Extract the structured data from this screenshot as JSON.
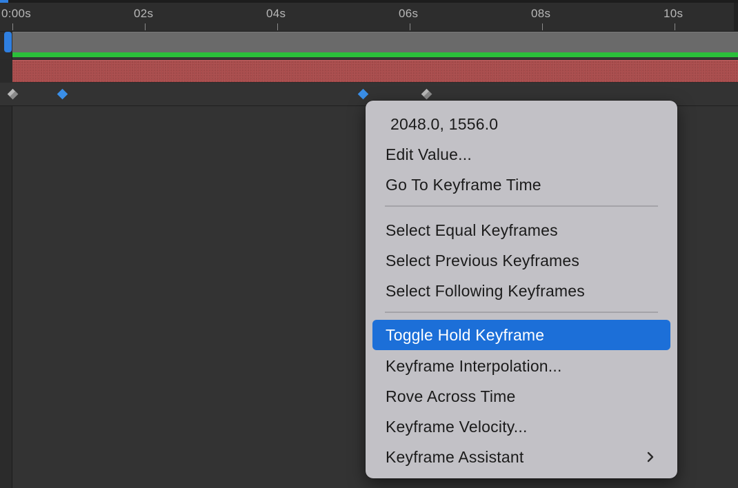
{
  "timeline": {
    "ruler_labels": [
      "0:00s",
      "02s",
      "04s",
      "06s",
      "08s",
      "10s"
    ],
    "colors": {
      "work_bar": "#6a6a6a",
      "green_bar": "#2bbf3a",
      "layer_bar": "#a84a4a",
      "keyframe_selected": "#3a8fe8",
      "keyframe_unselected": "#b9b9b9",
      "playhead": "#2f7fe0"
    },
    "keyframes": [
      {
        "time": "00s",
        "selected": false
      },
      {
        "time": "0.75s",
        "selected": true
      },
      {
        "time": "5.3s",
        "selected": true
      },
      {
        "time": "6.25s",
        "selected": false
      }
    ]
  },
  "context_menu": {
    "value": "2048.0, 1556.0",
    "group1": [
      "Edit Value...",
      "Go To Keyframe Time"
    ],
    "group2": [
      "Select Equal Keyframes",
      "Select Previous Keyframes",
      "Select Following Keyframes"
    ],
    "group3": [
      "Toggle Hold Keyframe",
      "Keyframe Interpolation...",
      "Rove Across Time",
      "Keyframe Velocity...",
      "Keyframe Assistant"
    ],
    "selected_item": "Toggle Hold Keyframe",
    "submenu_icon": "chevron-right-icon",
    "highlight_color": "#1c6fd8"
  }
}
